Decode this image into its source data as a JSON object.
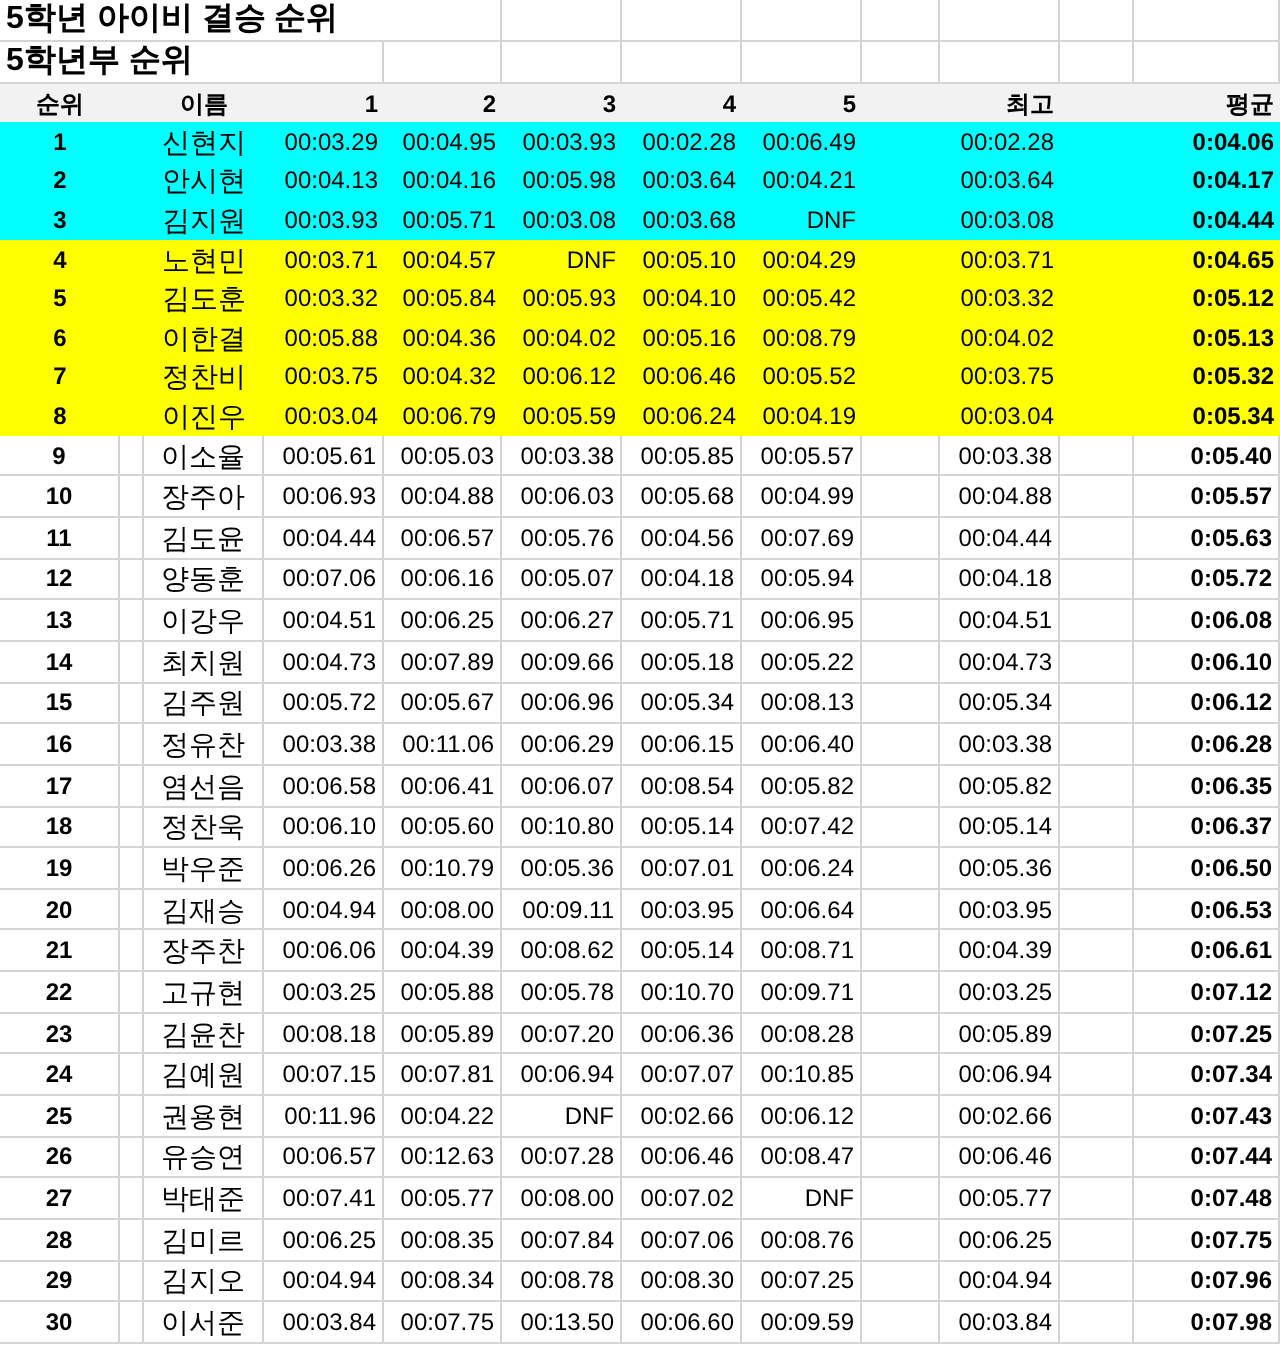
{
  "title": "5학년 아이비 결승 순위",
  "subtitle": "5학년부 순위",
  "columns": {
    "rank": "순위",
    "name": "이름",
    "attempts": [
      "1",
      "2",
      "3",
      "4",
      "5"
    ],
    "best": "최고",
    "average": "평균"
  },
  "rows": [
    {
      "rank": "1",
      "name": "신현지",
      "times": [
        "00:03.29",
        "00:04.95",
        "00:03.93",
        "00:02.28",
        "00:06.49"
      ],
      "best": "00:02.28",
      "average": "0:04.06",
      "color": "#00ffff"
    },
    {
      "rank": "2",
      "name": "안시현",
      "times": [
        "00:04.13",
        "00:04.16",
        "00:05.98",
        "00:03.64",
        "00:04.21"
      ],
      "best": "00:03.64",
      "average": "0:04.17",
      "color": "#00ffff"
    },
    {
      "rank": "3",
      "name": "김지원",
      "times": [
        "00:03.93",
        "00:05.71",
        "00:03.08",
        "00:03.68",
        "DNF"
      ],
      "best": "00:03.08",
      "average": "0:04.44",
      "color": "#00ffff"
    },
    {
      "rank": "4",
      "name": "노현민",
      "times": [
        "00:03.71",
        "00:04.57",
        "DNF",
        "00:05.10",
        "00:04.29"
      ],
      "best": "00:03.71",
      "average": "0:04.65",
      "color": "#ffff00"
    },
    {
      "rank": "5",
      "name": "김도훈",
      "times": [
        "00:03.32",
        "00:05.84",
        "00:05.93",
        "00:04.10",
        "00:05.42"
      ],
      "best": "00:03.32",
      "average": "0:05.12",
      "color": "#ffff00"
    },
    {
      "rank": "6",
      "name": "이한결",
      "times": [
        "00:05.88",
        "00:04.36",
        "00:04.02",
        "00:05.16",
        "00:08.79"
      ],
      "best": "00:04.02",
      "average": "0:05.13",
      "color": "#ffff00"
    },
    {
      "rank": "7",
      "name": "정찬비",
      "times": [
        "00:03.75",
        "00:04.32",
        "00:06.12",
        "00:06.46",
        "00:05.52"
      ],
      "best": "00:03.75",
      "average": "0:05.32",
      "color": "#ffff00"
    },
    {
      "rank": "8",
      "name": "이진우",
      "times": [
        "00:03.04",
        "00:06.79",
        "00:05.59",
        "00:06.24",
        "00:04.19"
      ],
      "best": "00:03.04",
      "average": "0:05.34",
      "color": "#ffff00"
    },
    {
      "rank": "9",
      "name": "이소율",
      "times": [
        "00:05.61",
        "00:05.03",
        "00:03.38",
        "00:05.85",
        "00:05.57"
      ],
      "best": "00:03.38",
      "average": "0:05.40",
      "color": "#ffffff"
    },
    {
      "rank": "10",
      "name": "장주아",
      "times": [
        "00:06.93",
        "00:04.88",
        "00:06.03",
        "00:05.68",
        "00:04.99"
      ],
      "best": "00:04.88",
      "average": "0:05.57",
      "color": "#ffffff"
    },
    {
      "rank": "11",
      "name": "김도윤",
      "times": [
        "00:04.44",
        "00:06.57",
        "00:05.76",
        "00:04.56",
        "00:07.69"
      ],
      "best": "00:04.44",
      "average": "0:05.63",
      "color": "#ffffff"
    },
    {
      "rank": "12",
      "name": "양동훈",
      "times": [
        "00:07.06",
        "00:06.16",
        "00:05.07",
        "00:04.18",
        "00:05.94"
      ],
      "best": "00:04.18",
      "average": "0:05.72",
      "color": "#ffffff"
    },
    {
      "rank": "13",
      "name": "이강우",
      "times": [
        "00:04.51",
        "00:06.25",
        "00:06.27",
        "00:05.71",
        "00:06.95"
      ],
      "best": "00:04.51",
      "average": "0:06.08",
      "color": "#ffffff"
    },
    {
      "rank": "14",
      "name": "최치원",
      "times": [
        "00:04.73",
        "00:07.89",
        "00:09.66",
        "00:05.18",
        "00:05.22"
      ],
      "best": "00:04.73",
      "average": "0:06.10",
      "color": "#ffffff"
    },
    {
      "rank": "15",
      "name": "김주원",
      "times": [
        "00:05.72",
        "00:05.67",
        "00:06.96",
        "00:05.34",
        "00:08.13"
      ],
      "best": "00:05.34",
      "average": "0:06.12",
      "color": "#ffffff"
    },
    {
      "rank": "16",
      "name": "정유찬",
      "times": [
        "00:03.38",
        "00:11.06",
        "00:06.29",
        "00:06.15",
        "00:06.40"
      ],
      "best": "00:03.38",
      "average": "0:06.28",
      "color": "#ffffff"
    },
    {
      "rank": "17",
      "name": "염선음",
      "times": [
        "00:06.58",
        "00:06.41",
        "00:06.07",
        "00:08.54",
        "00:05.82"
      ],
      "best": "00:05.82",
      "average": "0:06.35",
      "color": "#ffffff"
    },
    {
      "rank": "18",
      "name": "정찬욱",
      "times": [
        "00:06.10",
        "00:05.60",
        "00:10.80",
        "00:05.14",
        "00:07.42"
      ],
      "best": "00:05.14",
      "average": "0:06.37",
      "color": "#ffffff"
    },
    {
      "rank": "19",
      "name": "박우준",
      "times": [
        "00:06.26",
        "00:10.79",
        "00:05.36",
        "00:07.01",
        "00:06.24"
      ],
      "best": "00:05.36",
      "average": "0:06.50",
      "color": "#ffffff"
    },
    {
      "rank": "20",
      "name": "김재승",
      "times": [
        "00:04.94",
        "00:08.00",
        "00:09.11",
        "00:03.95",
        "00:06.64"
      ],
      "best": "00:03.95",
      "average": "0:06.53",
      "color": "#ffffff"
    },
    {
      "rank": "21",
      "name": "장주찬",
      "times": [
        "00:06.06",
        "00:04.39",
        "00:08.62",
        "00:05.14",
        "00:08.71"
      ],
      "best": "00:04.39",
      "average": "0:06.61",
      "color": "#ffffff"
    },
    {
      "rank": "22",
      "name": "고규현",
      "times": [
        "00:03.25",
        "00:05.88",
        "00:05.78",
        "00:10.70",
        "00:09.71"
      ],
      "best": "00:03.25",
      "average": "0:07.12",
      "color": "#ffffff"
    },
    {
      "rank": "23",
      "name": "김윤찬",
      "times": [
        "00:08.18",
        "00:05.89",
        "00:07.20",
        "00:06.36",
        "00:08.28"
      ],
      "best": "00:05.89",
      "average": "0:07.25",
      "color": "#ffffff"
    },
    {
      "rank": "24",
      "name": "김예원",
      "times": [
        "00:07.15",
        "00:07.81",
        "00:06.94",
        "00:07.07",
        "00:10.85"
      ],
      "best": "00:06.94",
      "average": "0:07.34",
      "color": "#ffffff"
    },
    {
      "rank": "25",
      "name": "권용현",
      "times": [
        "00:11.96",
        "00:04.22",
        "DNF",
        "00:02.66",
        "00:06.12"
      ],
      "best": "00:02.66",
      "average": "0:07.43",
      "color": "#ffffff"
    },
    {
      "rank": "26",
      "name": "유승연",
      "times": [
        "00:06.57",
        "00:12.63",
        "00:07.28",
        "00:06.46",
        "00:08.47"
      ],
      "best": "00:06.46",
      "average": "0:07.44",
      "color": "#ffffff"
    },
    {
      "rank": "27",
      "name": "박태준",
      "times": [
        "00:07.41",
        "00:05.77",
        "00:08.00",
        "00:07.02",
        "DNF"
      ],
      "best": "00:05.77",
      "average": "0:07.48",
      "color": "#ffffff"
    },
    {
      "rank": "28",
      "name": "김미르",
      "times": [
        "00:06.25",
        "00:08.35",
        "00:07.84",
        "00:07.06",
        "00:08.76"
      ],
      "best": "00:06.25",
      "average": "0:07.75",
      "color": "#ffffff"
    },
    {
      "rank": "29",
      "name": "김지오",
      "times": [
        "00:04.94",
        "00:08.34",
        "00:08.78",
        "00:08.30",
        "00:07.25"
      ],
      "best": "00:04.94",
      "average": "0:07.96",
      "color": "#ffffff"
    },
    {
      "rank": "30",
      "name": "이서준",
      "times": [
        "00:03.84",
        "00:07.75",
        "00:13.50",
        "00:06.60",
        "00:09.59"
      ],
      "best": "00:03.84",
      "average": "0:07.98",
      "color": "#ffffff"
    }
  ]
}
